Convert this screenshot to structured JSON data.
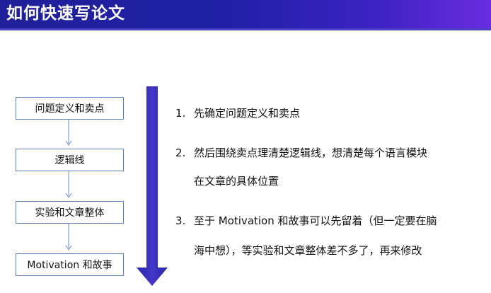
{
  "header": {
    "title": "如何快速写论文",
    "gradient": [
      "#20209a",
      "#6a2ce0"
    ]
  },
  "flow": {
    "steps": [
      {
        "label": "问题定义和卖点"
      },
      {
        "label": "逻辑线"
      },
      {
        "label": "实验和文章整体"
      },
      {
        "label": "Motivation 和故事"
      }
    ],
    "box_border_color": "#5b7fbf",
    "connector_color": "#6a8cc6"
  },
  "progress_arrow": {
    "color": "#3b32b8"
  },
  "points": [
    {
      "num": "1.",
      "lines": [
        "先确定问题定义和卖点"
      ]
    },
    {
      "num": "2.",
      "lines": [
        "然后围绕卖点理清楚逻辑线，想清楚每个语言模块",
        "在文章的具体位置"
      ]
    },
    {
      "num": "3.",
      "lines": [
        "至于 Motivation 和故事可以先留着（但一定要在脑",
        "海中想），等实验和文章整体差不多了，再来修改"
      ]
    }
  ]
}
